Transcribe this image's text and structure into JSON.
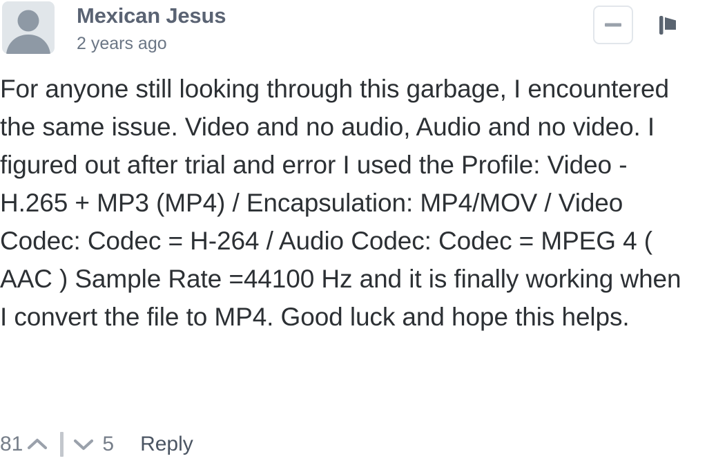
{
  "comment": {
    "author": "Mexican Jesus",
    "timestamp": "2 years ago",
    "avatar_icon": "user-avatar-placeholder-icon",
    "body": "For anyone still looking through this garbage, I encountered the same issue. Video and no audio, Audio and no video. I figured out after trial and error I used the Profile: Video - H.265 + MP3 (MP4) / Encapsulation: MP4/MOV / Video Codec: Codec = H-264 / Audio Codec: Codec = MPEG 4 ( AAC ) Sample Rate =44100 Hz and it is finally working when I convert the file to MP4. Good luck and hope this helps.",
    "actions": {
      "collapse_icon": "minus-icon",
      "collapse_label": "",
      "flag_icon": "flag-icon",
      "flag_label": ""
    },
    "footer": {
      "upvote_count": "81",
      "upvote_icon": "chevron-up-icon",
      "downvote_count": "5",
      "downvote_icon": "chevron-down-icon",
      "reply_label": "Reply"
    }
  },
  "colors": {
    "body_text": "#2c3034",
    "author_text": "#5a6373",
    "meta_text": "#6b7685",
    "avatar_bg": "#e1e6ea",
    "avatar_fg": "#8e99a5",
    "icon": "#5a6470",
    "border": "#e2e6eb",
    "background": "#ffffff"
  }
}
